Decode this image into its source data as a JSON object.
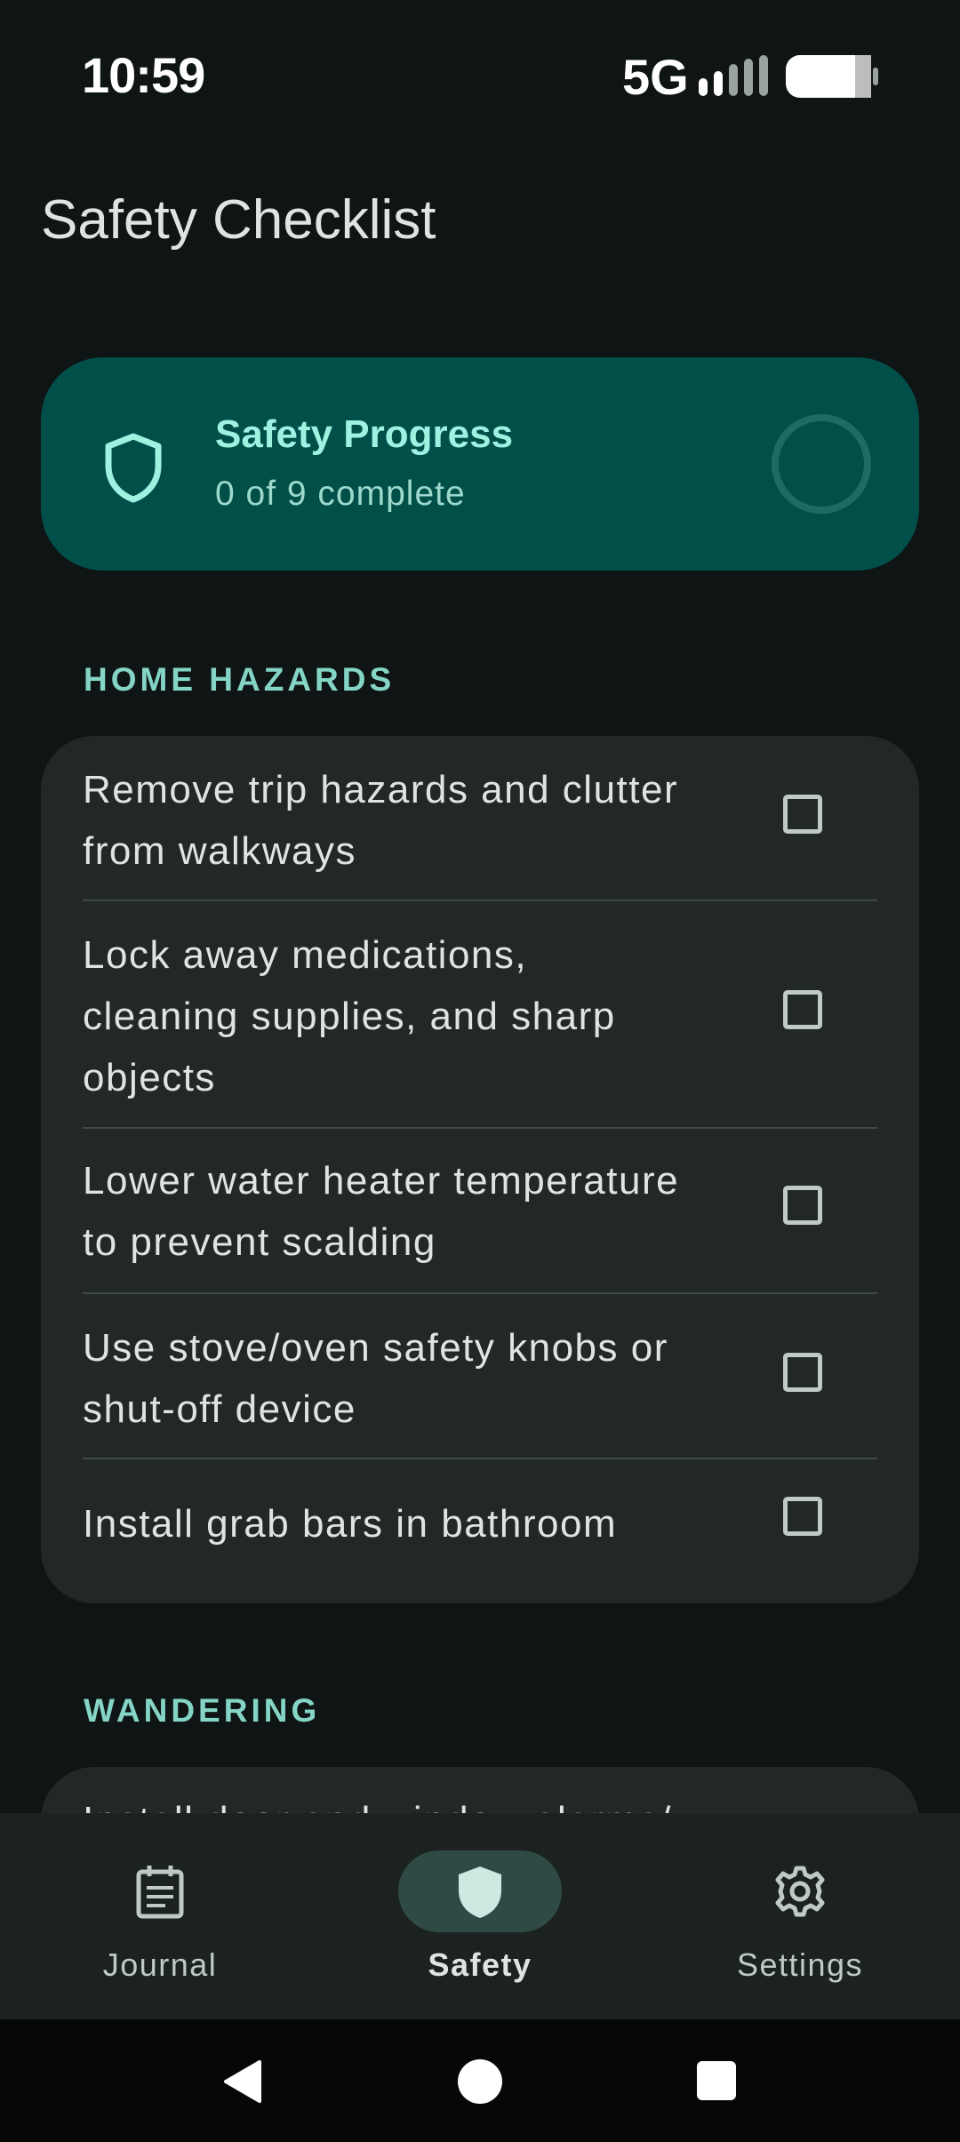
{
  "status_bar": {
    "time": "10:59",
    "network": "5G"
  },
  "page": {
    "title": "Safety Checklist"
  },
  "progress": {
    "title": "Safety Progress",
    "subtitle": "0 of 9 complete",
    "completed": 0,
    "total": 9
  },
  "sections": [
    {
      "title": "HOME HAZARDS",
      "items": [
        {
          "lines": [
            "Remove trip hazards and clutter",
            "from walkways"
          ],
          "checked": false
        },
        {
          "lines": [
            "Lock away medications,",
            "cleaning supplies, and sharp",
            "objects"
          ],
          "checked": false
        },
        {
          "lines": [
            "Lower water heater temperature",
            "to prevent scalding"
          ],
          "checked": false
        },
        {
          "lines": [
            "Use stove/oven safety knobs or",
            "shut-off device"
          ],
          "checked": false
        },
        {
          "lines": [
            "Install grab bars in bathroom"
          ],
          "checked": false
        }
      ]
    },
    {
      "title": "WANDERING",
      "items": [
        {
          "lines": [
            "Install door and window alarms/"
          ],
          "checked": false
        }
      ]
    }
  ],
  "bottom_nav": {
    "items": [
      {
        "label": "Journal",
        "icon": "journal-icon",
        "active": false
      },
      {
        "label": "Safety",
        "icon": "shield-icon",
        "active": true
      },
      {
        "label": "Settings",
        "icon": "gear-icon",
        "active": false
      }
    ]
  },
  "colors": {
    "accent": "#84d5c5",
    "card": "#004f48",
    "background": "#0f1514"
  }
}
